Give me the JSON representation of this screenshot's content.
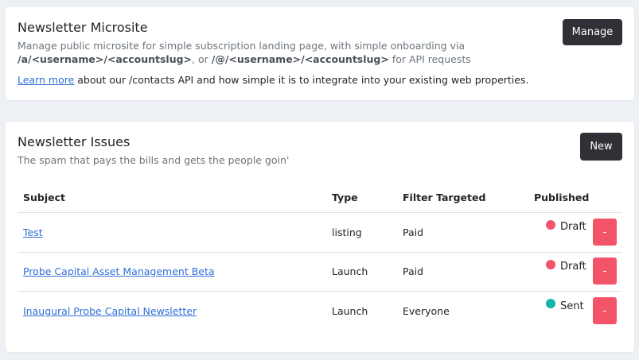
{
  "microsite": {
    "title": "Newsletter Microsite",
    "manage_label": "Manage",
    "desc_pre": "Manage public microsite for simple subscription landing page, with simple onboarding via",
    "path_a": "/a/<username>/<accountslug>",
    "desc_mid": ", or ",
    "path_b": "/@/<username>/<accountslug>",
    "desc_post": " for API requests",
    "learn_more_label": "Learn more",
    "learn_more_text": " about our /contacts API and how simple it is to integrate into your existing web properties."
  },
  "issues": {
    "title": "Newsletter Issues",
    "subtitle": "The spam that pays the bills and gets the people goin'",
    "new_label": "New",
    "columns": {
      "subject": "Subject",
      "type": "Type",
      "filter": "Filter Targeted",
      "published": "Published"
    },
    "rows": [
      {
        "subject": "Test",
        "type": "listing",
        "filter": "Paid",
        "status": "Draft",
        "status_color": "#f3546a",
        "delete_label": "-"
      },
      {
        "subject": "Probe Capital Asset Management Beta",
        "type": "Launch",
        "filter": "Paid",
        "status": "Draft",
        "status_color": "#f3546a",
        "delete_label": "-"
      },
      {
        "subject": "Inaugural Probe Capital Newsletter",
        "type": "Launch",
        "filter": "Everyone",
        "status": "Sent",
        "status_color": "#17b3a8",
        "delete_label": "-"
      }
    ]
  },
  "colors": {
    "background": "#edf1f5",
    "dark_button": "#2f3136",
    "danger": "#f3546a",
    "success": "#17b3a8",
    "link": "#2f6fd6"
  }
}
